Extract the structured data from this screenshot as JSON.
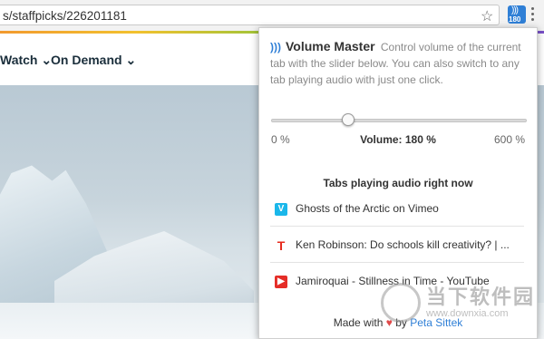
{
  "browser": {
    "url": "s/staffpicks/226201181",
    "extension_badge": "180"
  },
  "site": {
    "nav": [
      "Watch",
      "On Demand"
    ]
  },
  "popup": {
    "app_name": "Volume Master",
    "description": "Control volume of the current tab with the slider below. You can also switch to any tab playing audio with just one click.",
    "slider": {
      "min_label": "0 %",
      "max_label": "600 %",
      "volume_label": "Volume: 180 %",
      "value_percent": 180,
      "max_percent": 600
    },
    "tabs_heading": "Tabs playing audio right now",
    "tabs": [
      {
        "title": "Ghosts of the Arctic on Vimeo",
        "icon": "vimeo-icon",
        "icon_letter": "V",
        "icon_color": "#1ab7ea"
      },
      {
        "title": "Ken Robinson: Do schools kill creativity? | ...",
        "icon": "ted-icon",
        "icon_letter": "T",
        "icon_color": "#e62b1e"
      },
      {
        "title": "Jamiroquai - Stillness in Time - YouTube",
        "icon": "youtube-icon",
        "icon_letter": "▶",
        "icon_color": "#e52d27"
      }
    ],
    "footer": {
      "made_with": "Made with",
      "by": "by",
      "author": "Peta Sittek"
    }
  },
  "watermark": {
    "name": "当下软件园",
    "url": "www.downxia.com"
  }
}
